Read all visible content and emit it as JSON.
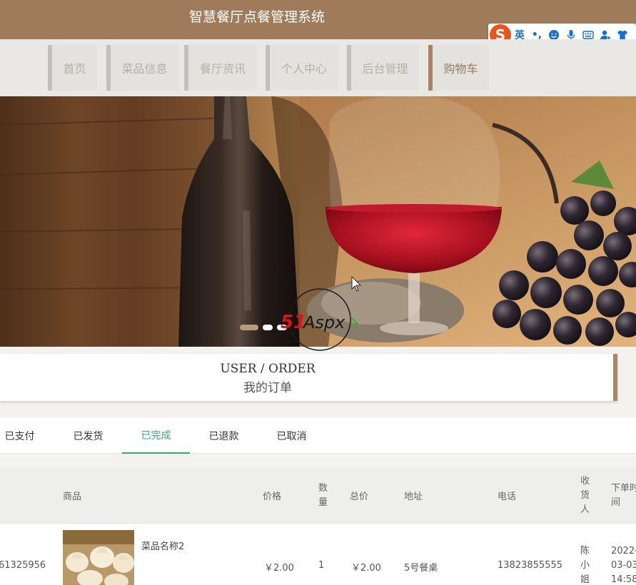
{
  "site": {
    "title": "智慧餐厅点餐管理系统"
  },
  "ime": {
    "logo": "S",
    "lang": "英",
    "punct": "•,"
  },
  "nav": [
    {
      "label": "首页"
    },
    {
      "label": "菜品信息"
    },
    {
      "label": "餐厅资讯"
    },
    {
      "label": "个人中心"
    },
    {
      "label": "后台管理"
    },
    {
      "label": "购物车"
    }
  ],
  "banner": {
    "slides_total": 3,
    "current_slide": 1
  },
  "section": {
    "title_en": "USER / ORDER",
    "title_cn": "我的订单"
  },
  "tabs": [
    {
      "label": "已支付"
    },
    {
      "label": "已发货"
    },
    {
      "label": "已完成"
    },
    {
      "label": "已退款"
    },
    {
      "label": "已取消"
    }
  ],
  "active_tab": "已完成",
  "table": {
    "headers": {
      "product": "商品",
      "price": "价格",
      "qty_1": "数",
      "qty_2": "量",
      "total": "总价",
      "address": "地址",
      "phone": "电话",
      "receiver_1": "收",
      "receiver_2": "货",
      "receiver_3": "人",
      "time_1": "下单时",
      "time_2": "间"
    },
    "row": {
      "order_no": "61325956",
      "product_name": "菜品名称2",
      "price": "￥2.00",
      "qty": "1",
      "total": "￥2.00",
      "address": "5号餐桌",
      "phone": "13823855555",
      "receiver_1": "陈",
      "receiver_2": "小",
      "receiver_3": "姐",
      "time_1": "2022-",
      "time_2": "03-03",
      "time_3": "14:58"
    }
  },
  "colors": {
    "brand": "#a07b5b",
    "active_tab": "#3aa676"
  }
}
